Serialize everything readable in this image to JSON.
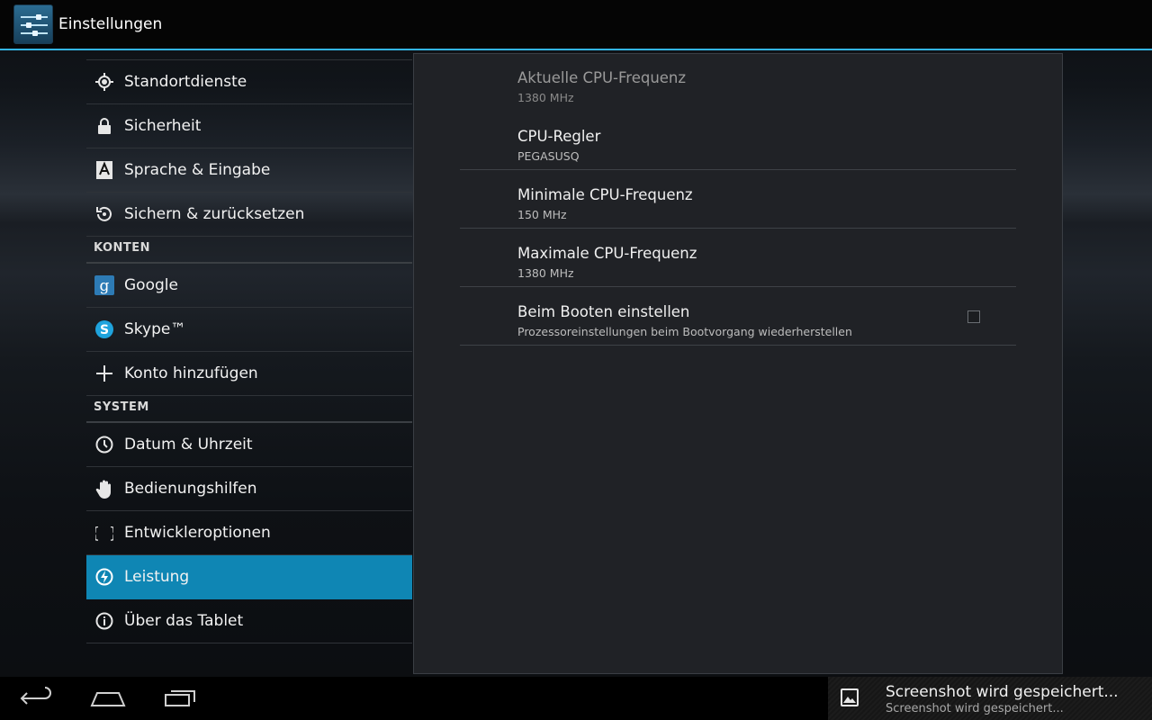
{
  "actionbar": {
    "title": "Einstellungen",
    "icon": "settings-sliders-icon"
  },
  "left_list": {
    "group1": [
      {
        "label": "Standortdienste",
        "icon": "location-icon"
      },
      {
        "label": "Sicherheit",
        "icon": "lock-icon"
      },
      {
        "label": "Sprache & Eingabe",
        "icon": "keyboard-a-icon"
      },
      {
        "label": "Sichern & zurücksetzen",
        "icon": "backup-restore-icon"
      }
    ],
    "section_konten": "KONTEN",
    "group2": [
      {
        "label": "Google",
        "icon": "google-icon"
      },
      {
        "label": "Skype™",
        "icon": "skype-icon"
      },
      {
        "label": "Konto hinzufügen",
        "icon": "plus-icon"
      }
    ],
    "section_system": "SYSTEM",
    "group3": [
      {
        "label": "Datum & Uhrzeit",
        "icon": "clock-icon"
      },
      {
        "label": "Bedienungshilfen",
        "icon": "hand-icon"
      },
      {
        "label": "Entwickleroptionen",
        "icon": "braces-icon"
      },
      {
        "label": "Leistung",
        "icon": "performance-bolt-icon",
        "selected": true
      },
      {
        "label": "Über das Tablet",
        "icon": "info-icon"
      }
    ]
  },
  "panel": {
    "prefs": [
      {
        "title": "Aktuelle CPU-Frequenz",
        "summary": "1380 MHz",
        "enabled": false
      },
      {
        "title": "CPU-Regler",
        "summary": "PEGASUSQ"
      },
      {
        "title": "Minimale CPU-Frequenz",
        "summary": "150 MHz"
      },
      {
        "title": "Maximale CPU-Frequenz",
        "summary": "1380 MHz"
      },
      {
        "title": "Beim Booten einstellen",
        "summary": "Prozessoreinstellungen beim Bootvorgang wiederherstellen",
        "checked": false
      }
    ]
  },
  "navbar": {
    "back": "back-icon",
    "home": "home-icon",
    "recents": "recents-icon"
  },
  "notification": {
    "title": "Screenshot wird gespeichert...",
    "text": "Screenshot wird gespeichert...",
    "icon": "image-icon"
  },
  "colors": {
    "accent": "#33b5e5",
    "selected": "#0f86b4"
  }
}
